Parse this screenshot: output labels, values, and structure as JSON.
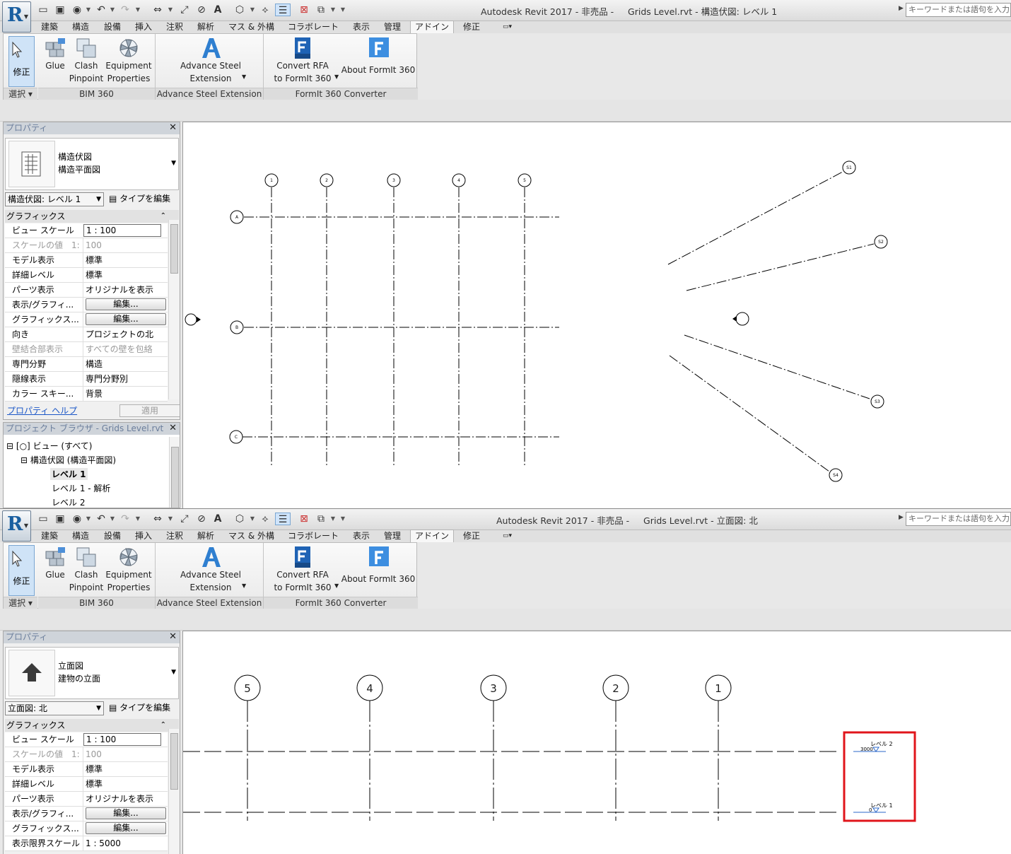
{
  "windows": [
    {
      "title": "Autodesk Revit 2017 - 非売品 -     Grids Level.rvt - 構造伏図: レベル 1",
      "search_placeholder": "キーワードまたは語句を入力",
      "tabs": [
        "建築",
        "構造",
        "設備",
        "挿入",
        "注釈",
        "解析",
        "マス & 外構",
        "コラボレート",
        "表示",
        "管理",
        "アドイン",
        "修正"
      ],
      "active_tab": "アドイン",
      "ribbon": {
        "modify": "修正",
        "select": "選択",
        "glue": "Glue",
        "clash1": "Clash",
        "clash2": "Pinpoint",
        "equip1": "Equipment",
        "equip2": "Properties",
        "adv1": "Advance Steel",
        "adv2": "Extension",
        "conv1": "Convert RFA",
        "conv2": "to FormIt 360",
        "about": "About FormIt 360",
        "panel_bim": "BIM 360",
        "panel_adv": "Advance Steel Extension",
        "panel_formit": "FormIt 360 Converter"
      },
      "properties": {
        "header": "プロパティ",
        "type1": "構造伏図",
        "type2": "構造平面図",
        "view_select": "構造伏図: レベル 1",
        "edit_type": "タイプを編集",
        "group": "グラフィックス",
        "rows": [
          {
            "k": "ビュー スケール",
            "v": "1 : 100"
          },
          {
            "k": "スケールの値　1:",
            "v": "100"
          },
          {
            "k": "モデル表示",
            "v": "標準"
          },
          {
            "k": "詳細レベル",
            "v": "標準"
          },
          {
            "k": "パーツ表示",
            "v": "オリジナルを表示"
          },
          {
            "k": "表示/グラフィ...",
            "v": "編集..."
          },
          {
            "k": "グラフィックス...",
            "v": "編集..."
          },
          {
            "k": "向き",
            "v": "プロジェクトの北"
          },
          {
            "k": "壁結合部表示",
            "v": "すべての壁を包絡"
          },
          {
            "k": "専門分野",
            "v": "構造"
          },
          {
            "k": "隠線表示",
            "v": "専門分野別"
          },
          {
            "k": "カラー スキー...",
            "v": "背景"
          }
        ],
        "help": "プロパティ ヘルプ",
        "apply": "適用"
      },
      "browser": {
        "header": "プロジェクト ブラウザ - Grids Level.rvt",
        "items": [
          "ビュー (すべて)",
          "構造伏図 (構造平面図)",
          "レベル 1",
          "レベル 1 - 解析",
          "レベル 2"
        ]
      },
      "plan": {
        "grid_numbers": [
          "1",
          "2",
          "3",
          "4",
          "5"
        ],
        "grid_letters": [
          "A",
          "B",
          "C"
        ],
        "radial": [
          "S1",
          "S2",
          "S3",
          "S4"
        ]
      }
    },
    {
      "title": "Autodesk Revit 2017 - 非売品 -     Grids Level.rvt - 立面図: 北",
      "search_placeholder": "キーワードまたは語句を入力",
      "tabs": [
        "建築",
        "構造",
        "設備",
        "挿入",
        "注釈",
        "解析",
        "マス & 外構",
        "コラボレート",
        "表示",
        "管理",
        "アドイン",
        "修正"
      ],
      "active_tab": "アドイン",
      "ribbon": {
        "modify": "修正",
        "select": "選択",
        "glue": "Glue",
        "clash1": "Clash",
        "clash2": "Pinpoint",
        "equip1": "Equipment",
        "equip2": "Properties",
        "adv1": "Advance Steel",
        "adv2": "Extension",
        "conv1": "Convert RFA",
        "conv2": "to FormIt 360",
        "about": "About FormIt 360",
        "panel_bim": "BIM 360",
        "panel_adv": "Advance Steel Extension",
        "panel_formit": "FormIt 360 Converter"
      },
      "properties": {
        "header": "プロパティ",
        "type1": "立面図",
        "type2": "建物の立面",
        "view_select": "立面図: 北",
        "edit_type": "タイプを編集",
        "group": "グラフィックス",
        "rows": [
          {
            "k": "ビュー スケール",
            "v": "1 : 100"
          },
          {
            "k": "スケールの値　1:",
            "v": "100"
          },
          {
            "k": "モデル表示",
            "v": "標準"
          },
          {
            "k": "詳細レベル",
            "v": "標準"
          },
          {
            "k": "パーツ表示",
            "v": "オリジナルを表示"
          },
          {
            "k": "表示/グラフィ...",
            "v": "編集..."
          },
          {
            "k": "グラフィックス...",
            "v": "編集..."
          },
          {
            "k": "表示限界スケール",
            "v": "1 : 5000"
          }
        ]
      },
      "elevation": {
        "grid_numbers": [
          "5",
          "4",
          "3",
          "2",
          "1"
        ],
        "level2_name": "レベル 2",
        "level2_value": "3000",
        "level1_name": "レベル 1",
        "level1_value": "0"
      }
    }
  ],
  "colors": {
    "highlight_box": "#e0151b",
    "level_marker": "#2b67c9",
    "active_button": "#cfe3f7"
  }
}
